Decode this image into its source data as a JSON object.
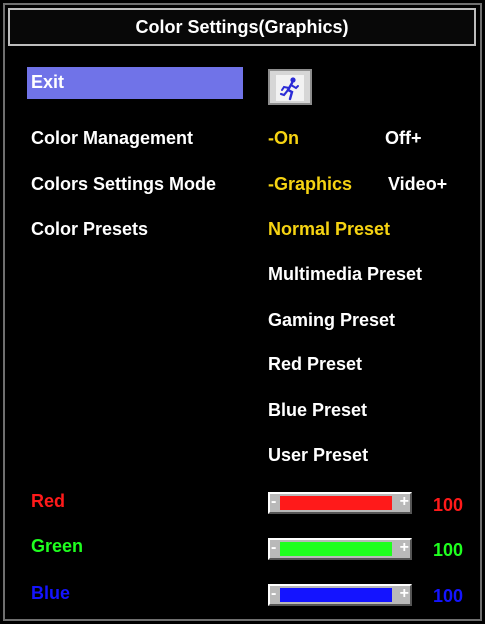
{
  "title": "Color Settings(Graphics)",
  "menu": {
    "exit_label": "Exit",
    "color_management": {
      "label": "Color Management",
      "options": [
        "-On",
        "Off+"
      ],
      "selected": "-On"
    },
    "colors_settings_mode": {
      "label": "Colors Settings Mode",
      "options": [
        "-Graphics",
        "Video+"
      ],
      "selected": "-Graphics"
    },
    "color_presets": {
      "label": "Color Presets",
      "items": [
        "Normal Preset",
        "Multimedia Preset",
        "Gaming Preset",
        "Red Preset",
        "Blue Preset",
        "User Preset"
      ],
      "selected": "Normal Preset"
    }
  },
  "sliders": [
    {
      "label": "Red",
      "value": "100",
      "level": 1.0,
      "color": "#ff1a1a"
    },
    {
      "label": "Green",
      "value": "100",
      "level": 1.0,
      "color": "#1fff1f"
    },
    {
      "label": "Blue",
      "value": "100",
      "level": 1.0,
      "color": "#1414ff"
    }
  ],
  "colors": {
    "highlight": "#7073e8",
    "selected_text": "#f6d312",
    "text": "#ffffff"
  },
  "icons": {
    "exit": "exit-person-icon"
  }
}
